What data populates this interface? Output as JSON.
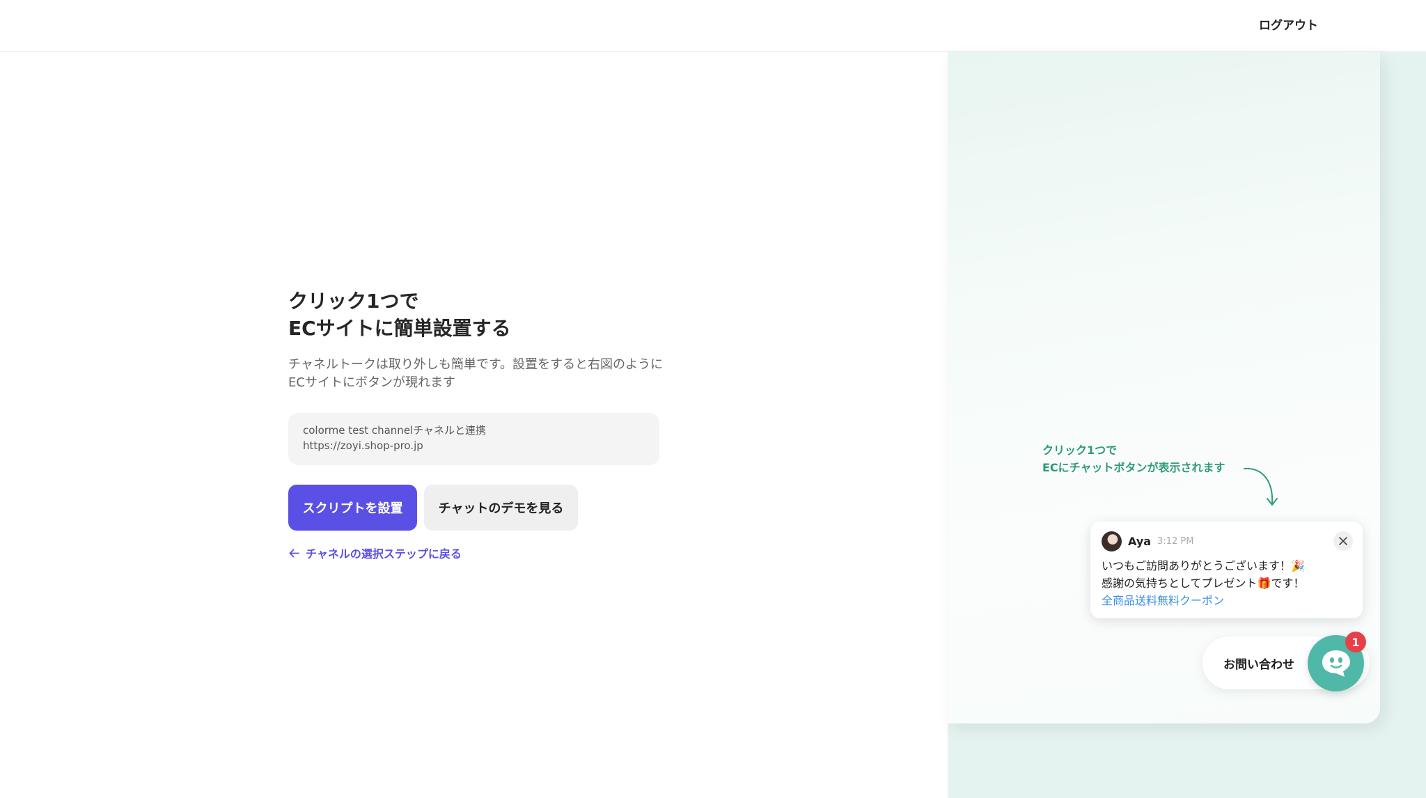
{
  "header": {
    "logout_label": "ログアウト"
  },
  "main": {
    "title_line1": "クリック1つで",
    "title_line2": "ECサイトに簡単設置する",
    "description": "チャネルトークは取り外しも簡単です。設置をすると右図のようにECサイトにボタンが現れます",
    "channel_name": "colorme test channelチャネルと連携",
    "channel_url": "https://zoyi.shop-pro.jp",
    "install_button": "スクリプトを設置",
    "demo_button": "チャットのデモを見る",
    "back_link": "チャネルの選択ステップに戻る"
  },
  "preview": {
    "annotation_line1": "クリック1つで",
    "annotation_line2": "ECにチャットボタンが表示されます",
    "chat": {
      "sender": "Aya",
      "time": "3:12 PM",
      "line1": "いつもご訪問ありがとうございます！🎉",
      "line2": "感謝の気持ちとしてプレゼント🎁です！",
      "link": "全商品送料無料クーポン"
    },
    "launcher_label": "お問い合わせ",
    "badge_count": "1"
  },
  "colors": {
    "primary": "#5b50e6",
    "annotation": "#2e9b76",
    "launcher": "#4fb8a8",
    "badge": "#e8404a",
    "link": "#3a8ee6"
  }
}
